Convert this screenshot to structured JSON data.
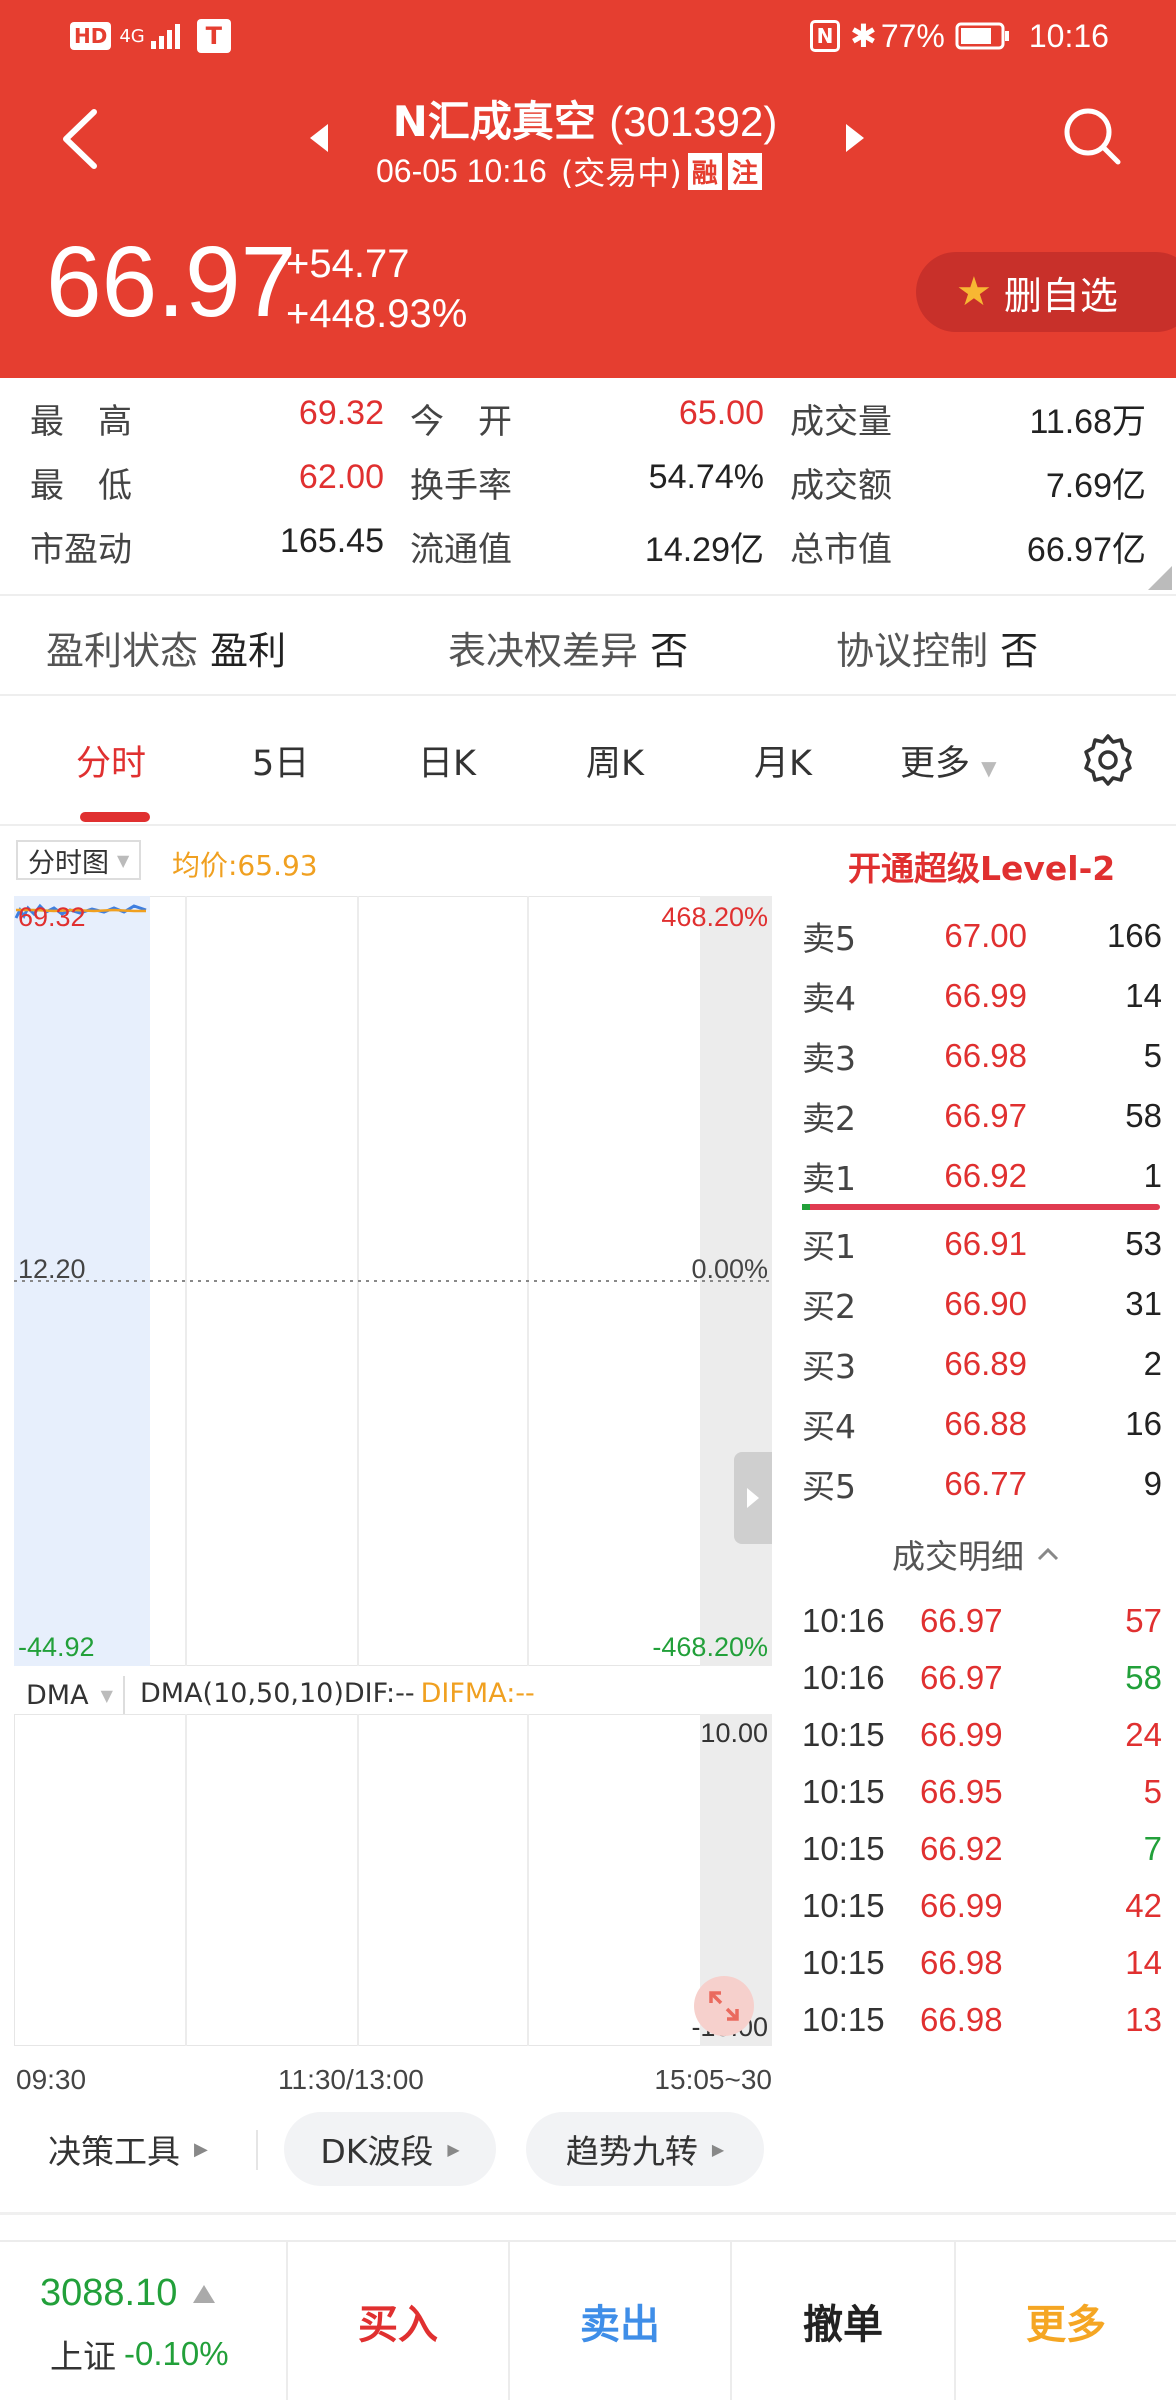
{
  "status_bar": {
    "left_badges": [
      "HD",
      "4G"
    ],
    "battery": "77%",
    "time": "10:16"
  },
  "header": {
    "name": "N汇成真空",
    "code": "(301392)",
    "datetime": "06-05 10:16",
    "state": "(交易中)",
    "badge_margin": "融",
    "badge_note": "注"
  },
  "quote": {
    "price": "66.97",
    "change": "+54.77",
    "pct": "+448.93%",
    "watch_button": "删自选"
  },
  "stats": [
    {
      "label": "最　高",
      "value": "69.32",
      "color": "red"
    },
    {
      "label": "今　开",
      "value": "65.00",
      "color": "red"
    },
    {
      "label": "成交量",
      "value": "11.68万",
      "color": "dark"
    },
    {
      "label": "最　低",
      "value": "62.00",
      "color": "red"
    },
    {
      "label": "换手率",
      "value": "54.74%",
      "color": "dark"
    },
    {
      "label": "成交额",
      "value": "7.69亿",
      "color": "dark"
    },
    {
      "label": "市盈动",
      "value": "165.45",
      "color": "dark"
    },
    {
      "label": "流通值",
      "value": "14.29亿",
      "color": "dark"
    },
    {
      "label": "总市值",
      "value": "66.97亿",
      "color": "dark"
    }
  ],
  "profile": [
    {
      "label": "盈利状态",
      "value": "盈利"
    },
    {
      "label": "表决权差异",
      "value": "否"
    },
    {
      "label": "协议控制",
      "value": "否"
    }
  ],
  "tabs": [
    "分时",
    "5日",
    "日K",
    "周K",
    "月K",
    "更多"
  ],
  "chart": {
    "selector": "分时图",
    "avg": "均价:65.93",
    "y_top_left": "69.32",
    "y_mid_left": "12.20",
    "y_bot_left": "-44.92",
    "y_top_right": "468.20%",
    "y_mid_right": "0.00%",
    "y_bot_right": "-468.20%",
    "x_labels": [
      "09:30",
      "11:30/13:00",
      "15:05~30"
    ]
  },
  "indicator": {
    "selector": "DMA",
    "params": "DMA(10,50,10)DIF:--",
    "difma": "DIFMA:--",
    "y_top": "10.00",
    "y_bot": "-10.00"
  },
  "level2": "开通超级Level-2",
  "orderbook": {
    "asks": [
      {
        "label": "卖5",
        "price": "67.00",
        "vol": "166"
      },
      {
        "label": "卖4",
        "price": "66.99",
        "vol": "14"
      },
      {
        "label": "卖3",
        "price": "66.98",
        "vol": "5"
      },
      {
        "label": "卖2",
        "price": "66.97",
        "vol": "58"
      },
      {
        "label": "卖1",
        "price": "66.92",
        "vol": "1"
      }
    ],
    "bids": [
      {
        "label": "买1",
        "price": "66.91",
        "vol": "53"
      },
      {
        "label": "买2",
        "price": "66.90",
        "vol": "31"
      },
      {
        "label": "买3",
        "price": "66.89",
        "vol": "2"
      },
      {
        "label": "买4",
        "price": "66.88",
        "vol": "16"
      },
      {
        "label": "买5",
        "price": "66.77",
        "vol": "9"
      }
    ]
  },
  "trades_title": "成交明细",
  "trades": [
    {
      "time": "10:16",
      "price": "66.97",
      "vol": "57",
      "dir": "red"
    },
    {
      "time": "10:16",
      "price": "66.97",
      "vol": "58",
      "dir": "green"
    },
    {
      "time": "10:15",
      "price": "66.99",
      "vol": "24",
      "dir": "red"
    },
    {
      "time": "10:15",
      "price": "66.95",
      "vol": "5",
      "dir": "red"
    },
    {
      "time": "10:15",
      "price": "66.92",
      "vol": "7",
      "dir": "green"
    },
    {
      "time": "10:15",
      "price": "66.99",
      "vol": "42",
      "dir": "red"
    },
    {
      "time": "10:15",
      "price": "66.98",
      "vol": "14",
      "dir": "red"
    },
    {
      "time": "10:15",
      "price": "66.98",
      "vol": "13",
      "dir": "red"
    }
  ],
  "tools": [
    "决策工具",
    "DK波段",
    "趋势九转"
  ],
  "index": {
    "value": "3088.10",
    "name": "上证",
    "pct": "-0.10%"
  },
  "actions": [
    "买入",
    "卖出",
    "撤单",
    "更多"
  ],
  "colors": {
    "brand_red": "#e53e30",
    "up": "#e03030",
    "down": "#22a03a",
    "sell_blue": "#3f8ee8",
    "more_orange": "#f5a623"
  }
}
